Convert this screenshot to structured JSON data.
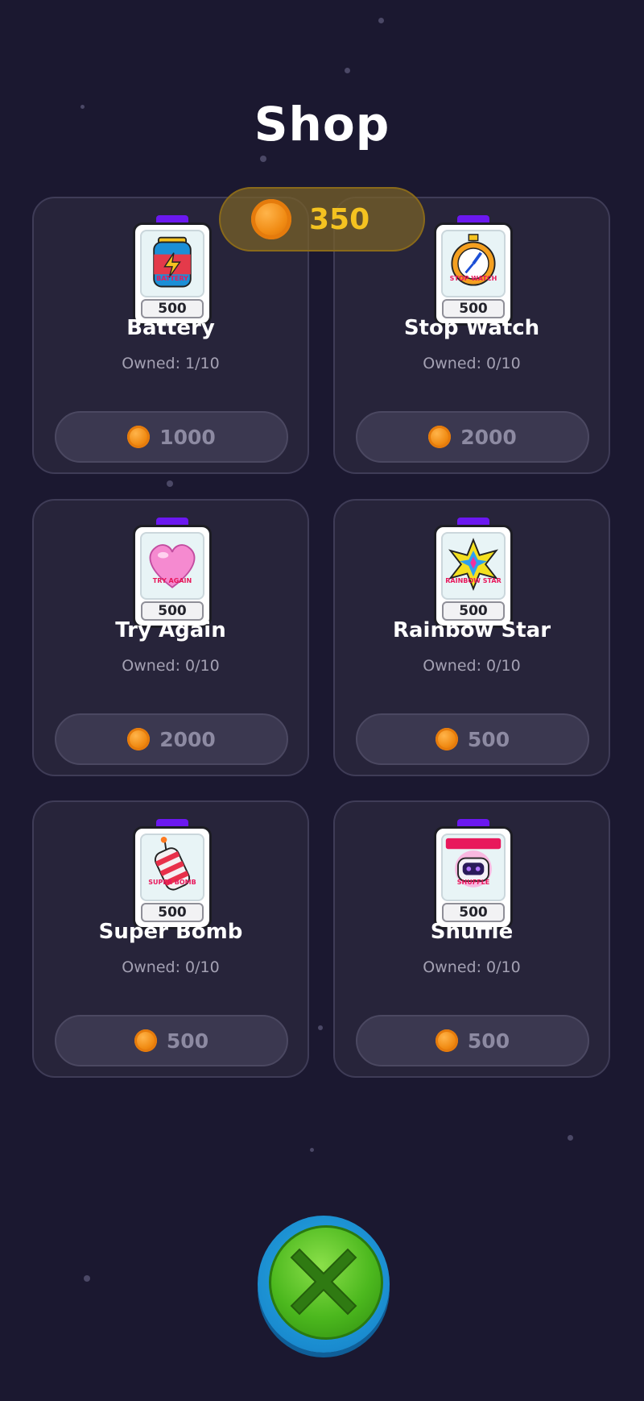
{
  "shop": {
    "title": "Shop",
    "balance": "350",
    "items": [
      {
        "name": "Battery",
        "art_label": "BATTERY",
        "badge": "500",
        "owned": "Owned: 1/10",
        "price": "1000",
        "icon": "battery-icon"
      },
      {
        "name": "Stop Watch",
        "art_label": "STOP WATCH",
        "badge": "500",
        "owned": "Owned: 0/10",
        "price": "2000",
        "icon": "stopwatch-icon"
      },
      {
        "name": "Try Again",
        "art_label": "TRY AGAIN",
        "badge": "500",
        "owned": "Owned: 0/10",
        "price": "2000",
        "icon": "heart-icon"
      },
      {
        "name": "Rainbow Star",
        "art_label": "RAINBOW STAR",
        "badge": "500",
        "owned": "Owned: 0/10",
        "price": "500",
        "icon": "rainbow-star-icon"
      },
      {
        "name": "Super Bomb",
        "art_label": "SUPER BOMB",
        "badge": "500",
        "owned": "Owned: 0/10",
        "price": "500",
        "icon": "firecracker-icon"
      },
      {
        "name": "Shuffle",
        "art_label": "SHUFFLE",
        "badge": "500",
        "owned": "Owned: 0/10",
        "price": "500",
        "icon": "shuffle-robot-icon"
      }
    ]
  },
  "colors": {
    "background": "#1b1830",
    "card": "#27243a",
    "coin": "#f08a12",
    "balance_text": "#f4c220",
    "close_button": "#4cb81e"
  }
}
